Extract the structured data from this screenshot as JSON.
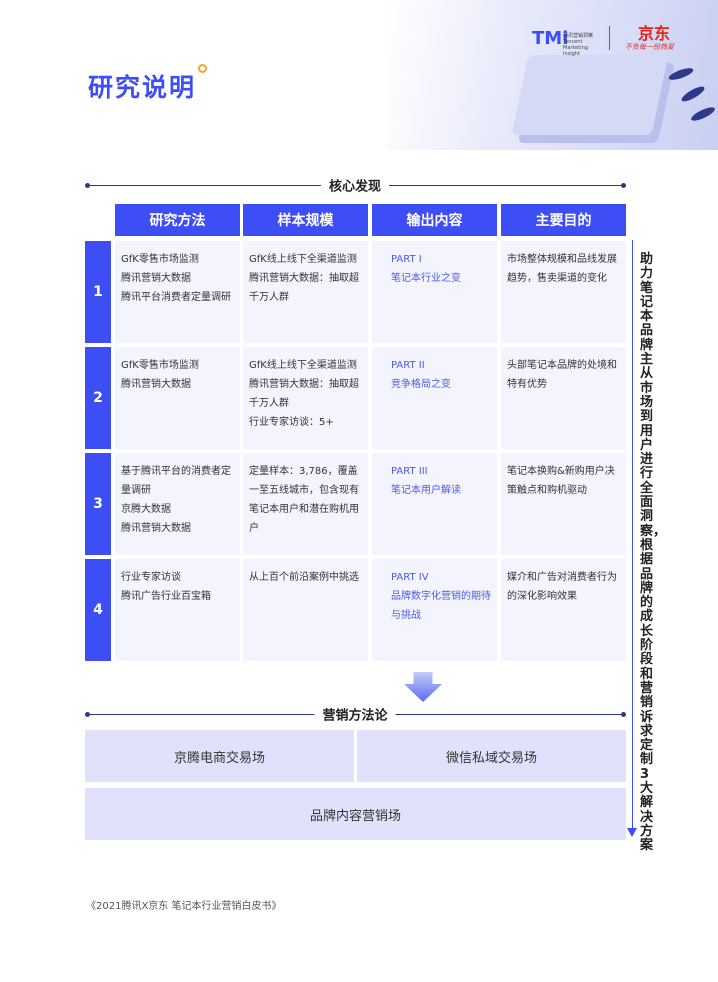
{
  "title": "研究说明",
  "logos": {
    "tmi": "TMi",
    "tmi_sub": "腾讯营销洞察 Tencent Marketing Insight",
    "jd": "京东",
    "jd_slogan": "不负每一份热爱"
  },
  "section1": "核心发现",
  "headers": [
    "研究方法",
    "样本规模",
    "输出内容",
    "主要目的"
  ],
  "rows": [
    {
      "num": "1",
      "method": [
        "GfK零售市场监测",
        "腾讯营销大数据",
        "腾讯平台消费者定量调研"
      ],
      "sample": [
        "GfK线上线下全渠道监测",
        "腾讯营销大数据：抽取超千万人群"
      ],
      "part": "PART I",
      "output": "笔记本行业之变",
      "purpose": "市场整体规模和品线发展趋势，售卖渠道的变化"
    },
    {
      "num": "2",
      "method": [
        "GfK零售市场监测",
        "腾讯营销大数据"
      ],
      "sample": [
        "GfK线上线下全渠道监测",
        "腾讯营销大数据：抽取超千万人群",
        "行业专家访谈：5+"
      ],
      "part": "PART II",
      "output": "竞争格局之变",
      "purpose": "头部笔记本品牌的处境和特有优势"
    },
    {
      "num": "3",
      "method": [
        "基于腾讯平台的消费者定量调研",
        "京腾大数据",
        "腾讯营销大数据"
      ],
      "sample": [
        "定量样本：3,786，覆盖一至五线城市，包含现有笔记本用户和潜在购机用户"
      ],
      "part": "PART III",
      "output": "笔记本用户解读",
      "purpose": "笔记本换购&新购用户决策触点和购机驱动"
    },
    {
      "num": "4",
      "method": [
        "行业专家访谈",
        "腾讯广告行业百宝箱"
      ],
      "sample": [
        "从上百个前沿案例中挑选"
      ],
      "part": "PART IV",
      "output": "品牌数字化营销的期待与挑战",
      "purpose": "媒介和广告对消费者行为的深化影响效果"
    }
  ],
  "section2": "营销方法论",
  "boxes": [
    "京腾电商交易场",
    "微信私域交易场",
    "品牌内容营销场"
  ],
  "side_text": "助力笔记本品牌主从市场到用户进行全面洞察，根据品牌的成长阶段和营销诉求定制3大解决方案",
  "footer": "《2021腾讯X京东 笔记本行业营销白皮书》"
}
